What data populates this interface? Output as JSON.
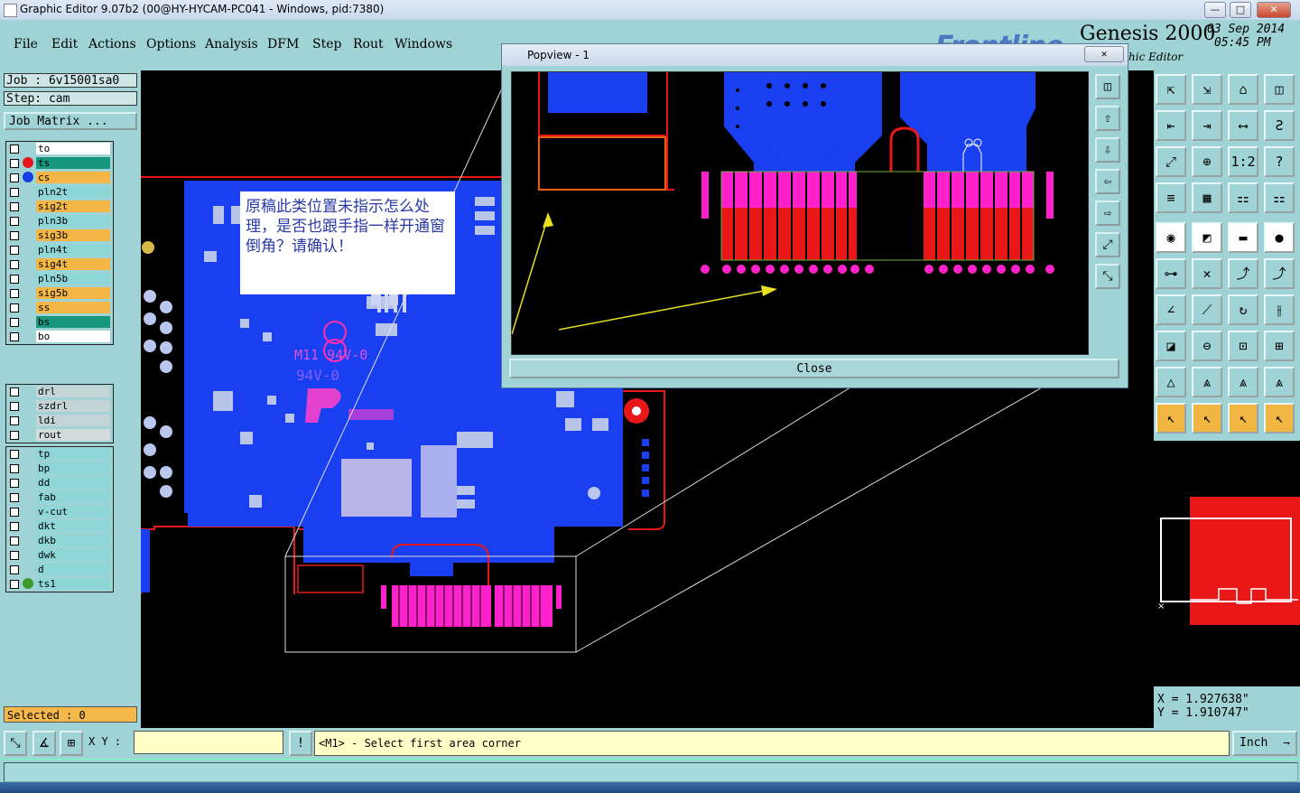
{
  "window": {
    "title": "Graphic Editor 9.07b2 (00@HY-HYCAM-PC041 - Windows, pid:7380)",
    "controls": {
      "minimize": "—",
      "maximize": "□",
      "close": "✕"
    }
  },
  "menu": {
    "items": [
      "File",
      "Edit",
      "Actions",
      "Options",
      "Analysis",
      "DFM",
      "Step",
      "Rout",
      "Windows"
    ]
  },
  "brand": {
    "logo": "Frontline",
    "product": "Genesis 2000",
    "subtitle": "hic Editor",
    "date": "03  Sep  2014",
    "time": "05:45  PM"
  },
  "job": {
    "job_line": "Job : 6v15001sa0",
    "step_line": "Step: cam",
    "matrix_button": "Job Matrix ..."
  },
  "layers_group1": [
    {
      "name": "to",
      "color": "#ffffff",
      "dot": ""
    },
    {
      "name": "ts",
      "color": "#16967d",
      "dot": "#e8141c"
    },
    {
      "name": "cs",
      "color": "#f4b746",
      "dot": "#1a3fe0"
    },
    {
      "name": "pln2t",
      "color": "#8fd6d8",
      "dot": ""
    },
    {
      "name": "sig2t",
      "color": "#f4b746",
      "dot": ""
    },
    {
      "name": "pln3b",
      "color": "#8fd6d8",
      "dot": ""
    },
    {
      "name": "sig3b",
      "color": "#f4b746",
      "dot": ""
    },
    {
      "name": "pln4t",
      "color": "#8fd6d8",
      "dot": ""
    },
    {
      "name": "sig4t",
      "color": "#f4b746",
      "dot": ""
    },
    {
      "name": "pln5b",
      "color": "#8fd6d8",
      "dot": ""
    },
    {
      "name": "sig5b",
      "color": "#f4b746",
      "dot": ""
    },
    {
      "name": "ss",
      "color": "#f4b746",
      "dot": ""
    },
    {
      "name": "bs",
      "color": "#16967d",
      "dot": ""
    },
    {
      "name": "bo",
      "color": "#ffffff",
      "dot": ""
    }
  ],
  "layers_group2": [
    {
      "name": "drl",
      "color": "#c4d4d6",
      "dot": ""
    },
    {
      "name": "szdrl",
      "color": "#c4d4d6",
      "dot": ""
    },
    {
      "name": "ldi",
      "color": "#c4d4d6",
      "dot": ""
    },
    {
      "name": "rout",
      "color": "#d2dcdc",
      "dot": ""
    }
  ],
  "layers_group3": [
    {
      "name": "tp",
      "color": "#8fd6d8",
      "dot": ""
    },
    {
      "name": "bp",
      "color": "#8fd6d8",
      "dot": ""
    },
    {
      "name": "dd",
      "color": "#8fd6d8",
      "dot": ""
    },
    {
      "name": "fab",
      "color": "#8fd6d8",
      "dot": ""
    },
    {
      "name": "v-cut",
      "color": "#8fd6d8",
      "dot": ""
    },
    {
      "name": "dkt",
      "color": "#8fd6d8",
      "dot": ""
    },
    {
      "name": "dkb",
      "color": "#8fd6d8",
      "dot": ""
    },
    {
      "name": "dwk",
      "color": "#8fd6d8",
      "dot": ""
    },
    {
      "name": "d",
      "color": "#8fd6d8",
      "dot": ""
    },
    {
      "name": "ts1",
      "color": "#8fd6d8",
      "dot": "#3a9a2a"
    }
  ],
  "selected": "Selected : 0",
  "annotation": "原稿此类位置未指示怎么处理，是否也跟手指一样开通窗倒角？请确认！",
  "silkscreen": {
    "ul_mark": "M11 94V-0",
    "ul_mark2": "94V-0"
  },
  "popview": {
    "title": "Popview - 1",
    "close_label": "Close",
    "side_buttons": [
      "◫",
      "⇧",
      "⇩",
      "⇦",
      "⇨",
      "⤢",
      "⤡"
    ]
  },
  "tools": {
    "rows": [
      [
        "⇱",
        "⇲",
        "⌂",
        "◫"
      ],
      [
        "⇤",
        "⇥",
        "⟷",
        "Ƨ"
      ],
      [
        "⤢",
        "⊕",
        "1:2",
        "?"
      ],
      [
        "≡",
        "▦",
        "⚏",
        "⚏"
      ],
      [
        "◉",
        "◩",
        "▬",
        "●"
      ],
      [
        "⊶",
        "✕",
        "⤴",
        "⤴"
      ],
      [
        "∠",
        "⟋",
        "↻",
        "⫲"
      ],
      [
        "◪",
        "⊖",
        "⊡",
        "⊞"
      ],
      [
        "△",
        "⩓",
        "⩓",
        "⩓"
      ],
      [
        "↖",
        "↖",
        "↖",
        "↖"
      ]
    ]
  },
  "coords": {
    "x": "X = 1.927638\"",
    "y": "Y = 1.910747\""
  },
  "status": {
    "xy_label": "X Y :",
    "xy_value": "",
    "alert_icon": "!",
    "prompt": "<M1> - Select first area corner",
    "units": "Inch"
  }
}
